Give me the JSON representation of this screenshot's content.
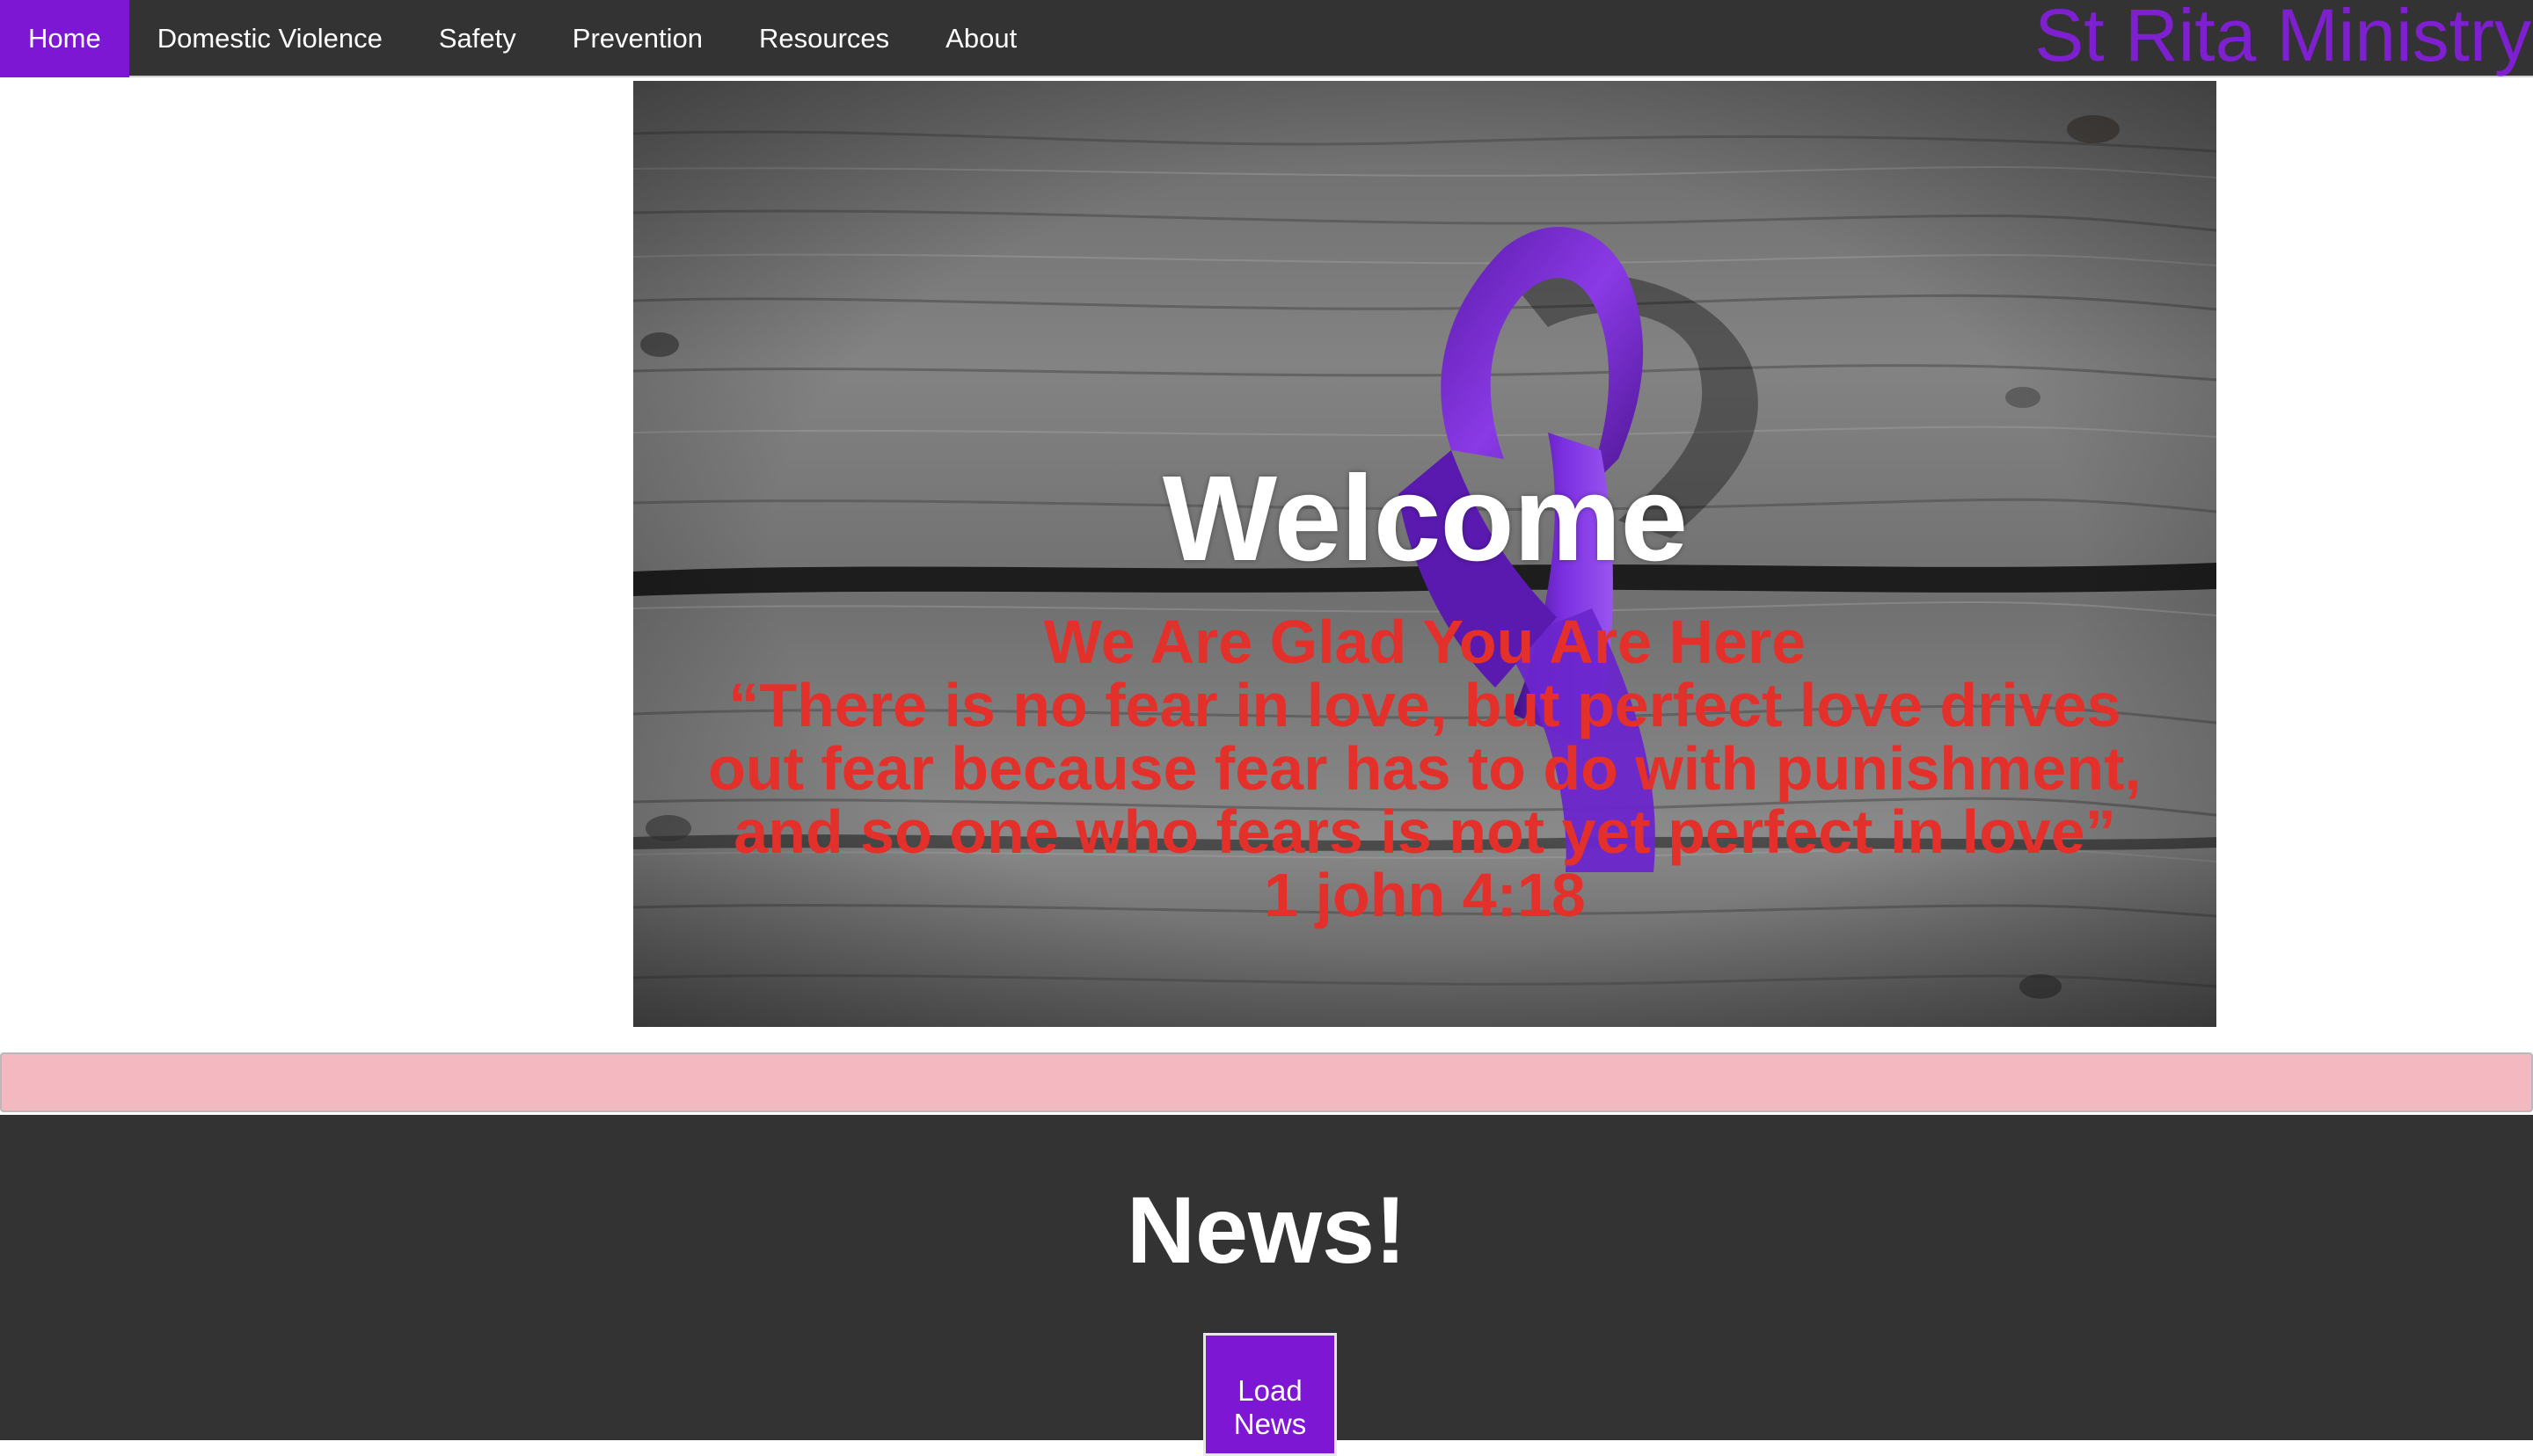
{
  "nav": {
    "items": [
      {
        "label": "Home",
        "active": true
      },
      {
        "label": "Domestic Violence",
        "active": false
      },
      {
        "label": "Safety",
        "active": false
      },
      {
        "label": "Prevention",
        "active": false
      },
      {
        "label": "Resources",
        "active": false
      },
      {
        "label": "About",
        "active": false
      }
    ],
    "brand": "St Rita Ministry"
  },
  "hero": {
    "image_icon": "purple-awareness-ribbon",
    "welcome": "Welcome",
    "verse_lines": [
      "We Are Glad You Are Here",
      "“There is no fear in love, but perfect love drives",
      "out fear because fear has to do with punishment,",
      "and so one who fears is not yet perfect in love”",
      "1 john 4:18"
    ]
  },
  "news": {
    "title": "News!",
    "button_line1": "Load",
    "button_line2": "News"
  },
  "colors": {
    "nav_bg": "#333333",
    "accent_purple": "#7e17d3",
    "brand_purple": "#7e1fd0",
    "verse_red": "#e4302b",
    "pink_bar": "#f3b8c0"
  }
}
